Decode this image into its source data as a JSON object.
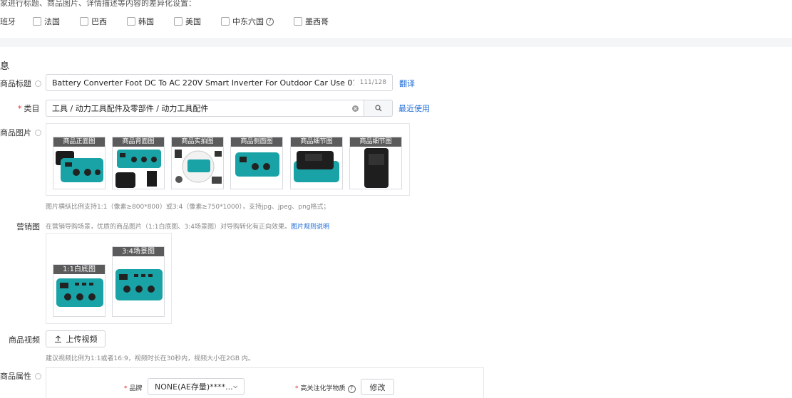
{
  "top_note": "家进行标题、商品图片、详情描述等内容的差异化设置：",
  "countries": [
    "班牙",
    "法国",
    "巴西",
    "韩国",
    "美国",
    "中东六国",
    "墨西哥"
  ],
  "section_title": "息",
  "title_field": {
    "label": "商品标题",
    "value": "Battery Converter Foot DC To AC 220V Smart Inverter For Outdoor Car Use 07394 Foot Inve",
    "count": "111/128",
    "translate_link": "翻译"
  },
  "category_field": {
    "label": "类目",
    "value": "工具 / 动力工具配件及零部件 / 动力工具配件",
    "recent_link": "最近使用"
  },
  "product_images": {
    "label": "商品图片",
    "tags": [
      "商品正面图",
      "商品背面图",
      "商品实拍图",
      "商品侧面图",
      "商品细节图",
      "商品细节图"
    ],
    "hint": "图片横纵比例支持1:1（像素≥800*800）或3:4（像素≥750*1000），支持jpg、jpeg、png格式；"
  },
  "marketing_images": {
    "label": "营销图",
    "hint": "在营销导购场景，优质的商品图片（1:1白底图、3:4场景图）对导购转化有正向效果。",
    "hint_link": "图片规则说明",
    "tags": [
      "1:1白底图",
      "3:4场景图"
    ]
  },
  "video": {
    "label": "商品视频",
    "upload_label": "上传视频",
    "hint": "建议视频比例为1:1或者16:9，视频时长在30秒内，视频大小在2GB 内。"
  },
  "attributes": {
    "label": "商品属性",
    "brand_label": "品牌",
    "brand_value": "NONE(AE存量)****...",
    "chem_label": "高关注化学物质",
    "modify_label": "修改"
  },
  "colors": {
    "accent": "#1f6dd8",
    "teal": "#1aa3a6",
    "tag_bg": "#5b5b5b",
    "required": "#e02f2f"
  }
}
